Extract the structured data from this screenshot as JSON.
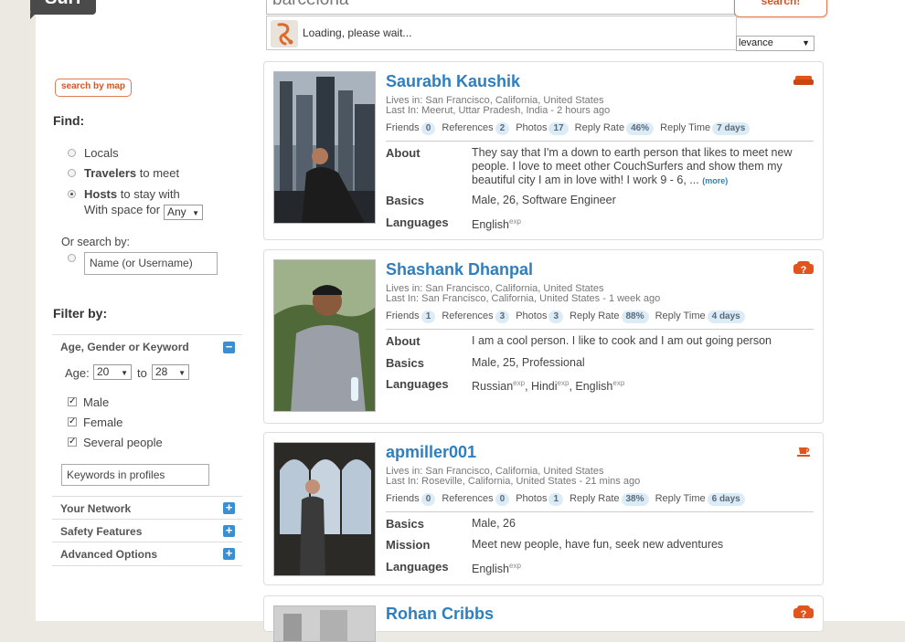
{
  "header": {
    "logo_text": "Surf",
    "search_value": "barcelona",
    "search_button": "search!",
    "loading_text": "Loading, please wait...",
    "sort_value": "levance"
  },
  "sidebar": {
    "map_button": "search by map",
    "find_title": "Find:",
    "locals": "Locals",
    "travelers_bold": "Travelers",
    "travelers_rest": "to meet",
    "hosts_bold": "Hosts",
    "hosts_rest": "to stay with",
    "space_label": "With space for",
    "space_value": "Any",
    "or_search": "Or search by:",
    "name_placeholder": "Name (or Username)",
    "filter_title": "Filter by:",
    "age_section": "Age, Gender or Keyword",
    "age_label": "Age:",
    "age_min": "20",
    "age_to": "to",
    "age_max": "28",
    "male": "Male",
    "female": "Female",
    "several": "Several people",
    "keywords_placeholder": "Keywords in profiles",
    "network": "Your Network",
    "safety": "Safety Features",
    "advanced": "Advanced Options"
  },
  "results": [
    {
      "name": "Saurabh Kaushik",
      "lives_in": "Lives in: San Francisco, California, United States",
      "last_in": "Last In:  Meerut, Uttar Pradesh, India - 2 hours ago",
      "friends": "0",
      "references": "2",
      "photos": "17",
      "reply_rate": "46%",
      "reply_time": "7 days",
      "rows": [
        {
          "label": "About",
          "value": "They say that I'm a down to earth person that likes to meet new people. I love to meet other CouchSurfers and show them my beautiful city I am in love with! I work 9 - 6, ...",
          "more": "(more)"
        },
        {
          "label": "Basics",
          "value": "Male, 26, Software Engineer"
        },
        {
          "label": "Languages",
          "value": "English",
          "sup": "exp"
        }
      ],
      "status_icon": "couch-icon"
    },
    {
      "name": "Shashank Dhanpal",
      "lives_in": "Lives in: San Francisco, California, United States",
      "last_in": "Last In:  San Francisco, California, United States - 1 week ago",
      "friends": "1",
      "references": "3",
      "photos": "3",
      "reply_rate": "88%",
      "reply_time": "4 days",
      "rows": [
        {
          "label": "About",
          "value": "I am a cool person. I like to cook and I am out going person"
        },
        {
          "label": "Basics",
          "value": "Male, 25, Professional"
        },
        {
          "label": "Languages",
          "langs": [
            "Russian",
            "Hindi",
            "English"
          ],
          "sup": "exp"
        }
      ],
      "status_icon": "maybe-icon"
    },
    {
      "name": "apmiller001",
      "lives_in": "Lives in: San Francisco, California, United States",
      "last_in": "Last In:  Roseville, California, United States - 21 mins ago",
      "friends": "0",
      "references": "0",
      "photos": "1",
      "reply_rate": "38%",
      "reply_time": "6 days",
      "rows": [
        {
          "label": "Basics",
          "value": "Male, 26"
        },
        {
          "label": "Mission",
          "value": "Meet new people, have fun, seek new adventures"
        },
        {
          "label": "Languages",
          "value": "English",
          "sup": "exp"
        }
      ],
      "status_icon": "coffee-icon"
    },
    {
      "name": "Rohan Cribbs",
      "status_icon": "maybe-icon"
    }
  ],
  "stat_labels": {
    "friends": "Friends",
    "references": "References",
    "photos": "Photos",
    "reply_rate": "Reply Rate",
    "reply_time": "Reply Time"
  },
  "colors": {
    "accent": "#d9531e",
    "link": "#2e7fbf",
    "badge_bg": "#dcecf6"
  }
}
